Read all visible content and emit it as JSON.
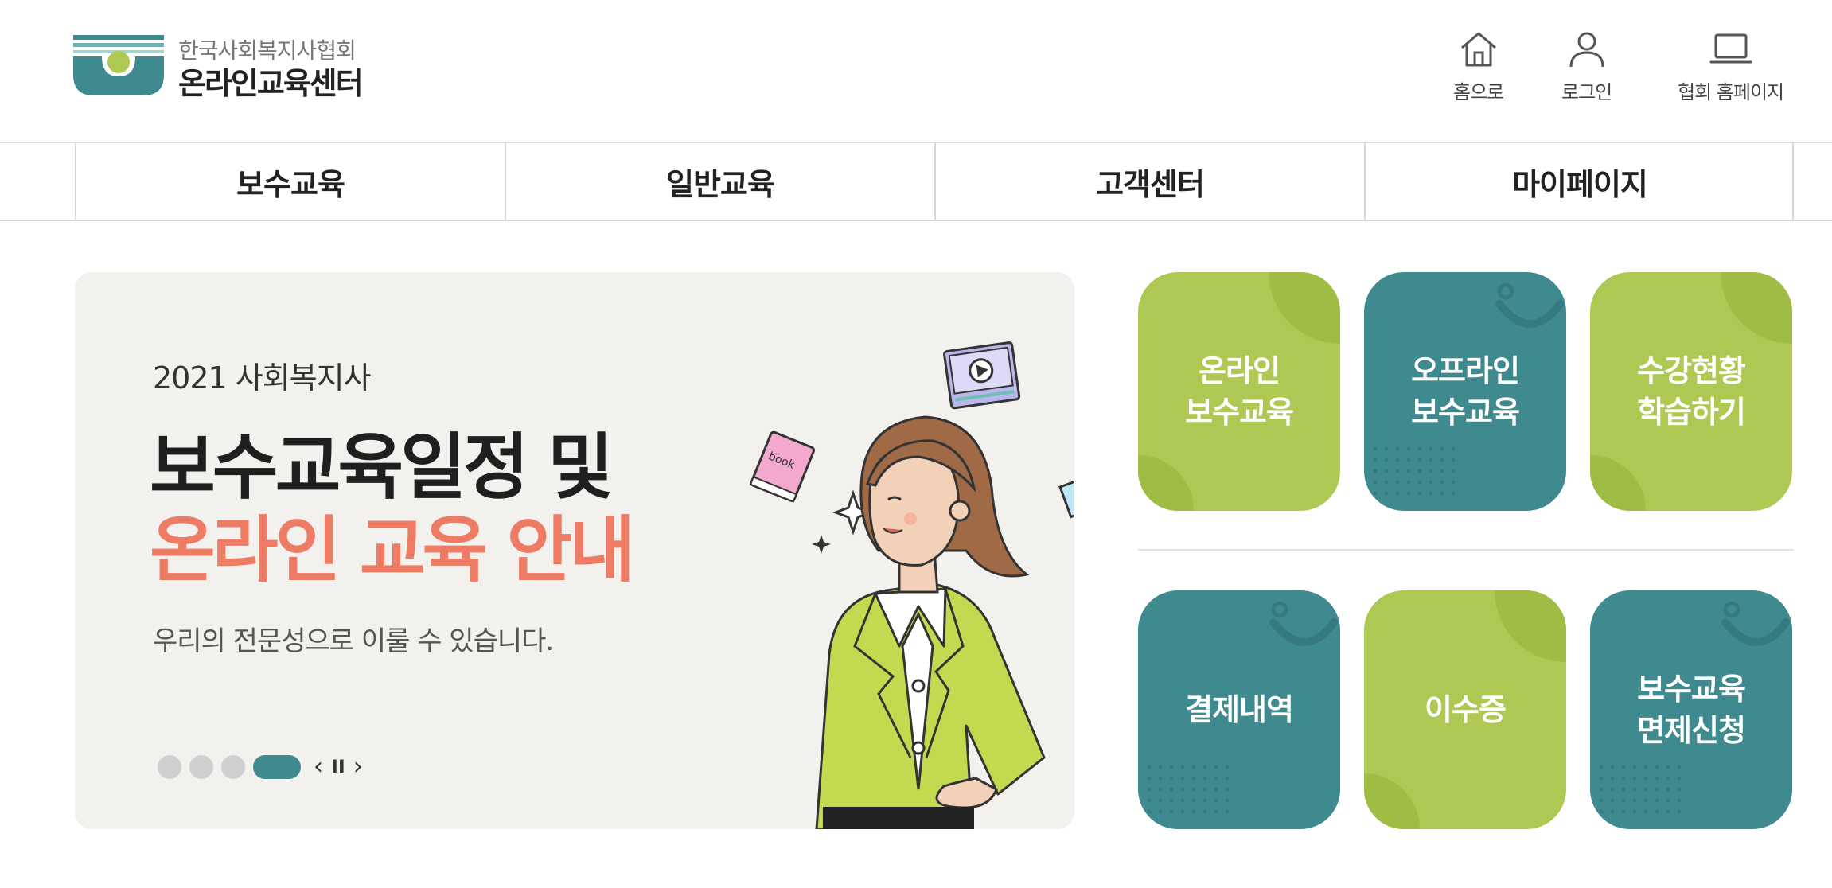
{
  "header": {
    "logo": {
      "subtitle": "한국사회복지사협회",
      "title": "온라인교육센터",
      "icon": "association-logo-icon"
    },
    "utility_links": [
      {
        "label": "홈으로",
        "icon": "home-icon"
      },
      {
        "label": "로그인",
        "icon": "user-icon"
      },
      {
        "label": "협회 홈페이지",
        "icon": "laptop-icon"
      }
    ]
  },
  "nav": {
    "items": [
      {
        "label": "보수교육"
      },
      {
        "label": "일반교육"
      },
      {
        "label": "고객센터"
      },
      {
        "label": "마이페이지"
      }
    ]
  },
  "banner": {
    "year_label": "2021 사회복지사",
    "headline_1": "보수교육일정 및",
    "headline_2": "온라인 교육 안내",
    "subtext": "우리의 전문성으로 이룰 수 있습니다.",
    "slide_count": 4,
    "active_slide": 4,
    "controls": {
      "prev": "‹",
      "pause": "II",
      "next": "›"
    },
    "illustration_text": "book",
    "colors": {
      "background": "#f3f1ee",
      "highlight": "#ee7b63",
      "active_dot": "#3e8a8f"
    }
  },
  "quick_menu": {
    "tiles": [
      {
        "label": "온라인\n보수교육",
        "color": "green"
      },
      {
        "label": "오프라인\n보수교육",
        "color": "teal"
      },
      {
        "label": "수강현황\n학습하기",
        "color": "green"
      },
      {
        "label": "결제내역",
        "color": "teal"
      },
      {
        "label": "이수증",
        "color": "green"
      },
      {
        "label": "보수교육\n면제신청",
        "color": "teal"
      }
    ],
    "colors": {
      "green": "#adc953",
      "teal": "#3e8a8f"
    }
  }
}
